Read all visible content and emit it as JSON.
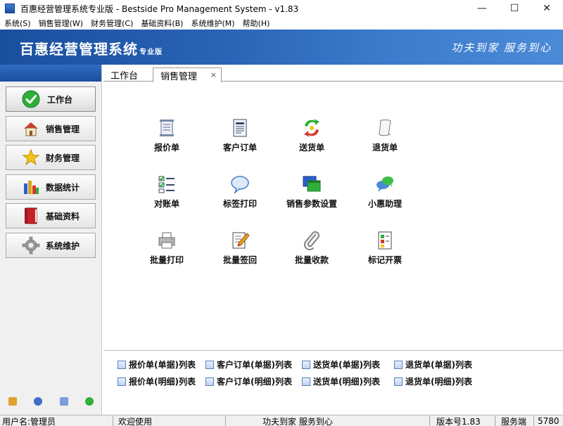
{
  "window": {
    "title": "百惠经营管理系统专业版 - Bestside Pro Management System - v1.83",
    "minimize": "—",
    "maximize": "☐",
    "close": "✕"
  },
  "menu": [
    "系统(S)",
    "销售管理(W)",
    "财务管理(C)",
    "基础资料(B)",
    "系统维护(M)",
    "帮助(H)"
  ],
  "banner": {
    "title": "百惠经营管理系统",
    "edition": "专业版",
    "slogan": "功夫到家 服务到心"
  },
  "sidebar": {
    "items": [
      {
        "label": "工作台",
        "icon": "checkmark-icon"
      },
      {
        "label": "销售管理",
        "icon": "house-icon"
      },
      {
        "label": "财务管理",
        "icon": "star-icon"
      },
      {
        "label": "数据统计",
        "icon": "bar-chart-icon"
      },
      {
        "label": "基础资料",
        "icon": "book-icon"
      },
      {
        "label": "系统维护",
        "icon": "gear-icon"
      }
    ]
  },
  "tabs": {
    "workbench": "工作台",
    "sales": "销售管理",
    "close": "×"
  },
  "actions": [
    {
      "label": "报价单",
      "icon": "scroll-icon"
    },
    {
      "label": "客户订单",
      "icon": "order-form-icon"
    },
    {
      "label": "送货单",
      "icon": "recycle-arrows-icon"
    },
    {
      "label": "退货单",
      "icon": "curled-paper-icon"
    },
    {
      "label": "对账单",
      "icon": "checklist-icon"
    },
    {
      "label": "标签打印",
      "icon": "speech-bubble-icon"
    },
    {
      "label": "销售参数设置",
      "icon": "windows-icon"
    },
    {
      "label": "小惠助理",
      "icon": "chat-bubbles-icon"
    },
    {
      "label": "批量打印",
      "icon": "printer-icon"
    },
    {
      "label": "批量签回",
      "icon": "pencil-note-icon"
    },
    {
      "label": "批量收款",
      "icon": "paperclip-icon"
    },
    {
      "label": "标记开票",
      "icon": "colored-blocks-icon"
    }
  ],
  "quick_links": [
    "报价单(单据)列表",
    "客户订单(单据)列表",
    "送货单(单据)列表",
    "退货单(单据)列表",
    "报价单(明细)列表",
    "客户订单(明细)列表",
    "送货单(明细)列表",
    "退货单(明细)列表"
  ],
  "status": {
    "user": "用户名:管理员",
    "welcome": "欢迎使用",
    "slogan": "功夫到家 服务到心",
    "version": "版本号1.83",
    "service": "服务端",
    "code": "5780"
  },
  "colors": {
    "banner_start": "#1a4f9e",
    "banner_end": "#4b8ad6"
  }
}
